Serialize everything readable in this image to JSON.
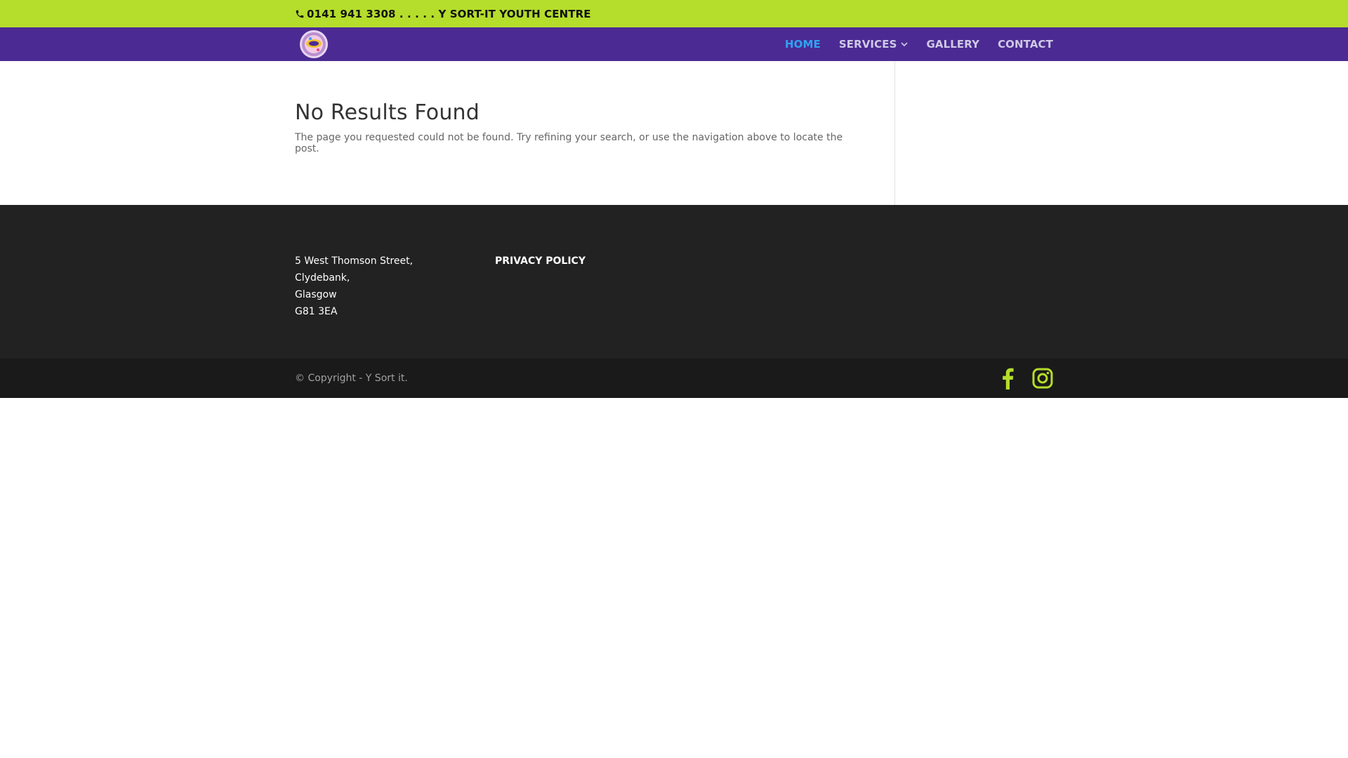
{
  "top_bar": {
    "contact_text": "0141 941 3308 . . . . . Y SORT-IT YOUTH CENTRE",
    "phone_icon": "phone-icon"
  },
  "header": {
    "logo_icon": "site-logo",
    "nav": [
      {
        "label": "HOME",
        "active": true
      },
      {
        "label": "SERVICES",
        "has_dropdown": true
      },
      {
        "label": "GALLERY"
      },
      {
        "label": "CONTACT"
      }
    ]
  },
  "main": {
    "title": "No Results Found",
    "message": "The page you requested could not be found. Try refining your search, or use the navigation above to locate the post."
  },
  "footer": {
    "address": [
      "5 West Thomson Street,",
      "Clydebank,",
      "Glasgow",
      "G81 3EA"
    ],
    "privacy_link": "PRIVACY POLICY"
  },
  "bottom_bar": {
    "copyright": "© Copyright - Y Sort it.",
    "social": [
      "facebook-icon",
      "instagram-icon"
    ]
  },
  "colors": {
    "top_bar_bg": "#b5dd2b",
    "header_bg": "#4b2b93",
    "nav_active": "#2ea3f2",
    "footer_bg": "#222222",
    "bottom_bar_bg": "#1a1a1a",
    "social_icon": "#b5dd2b"
  }
}
